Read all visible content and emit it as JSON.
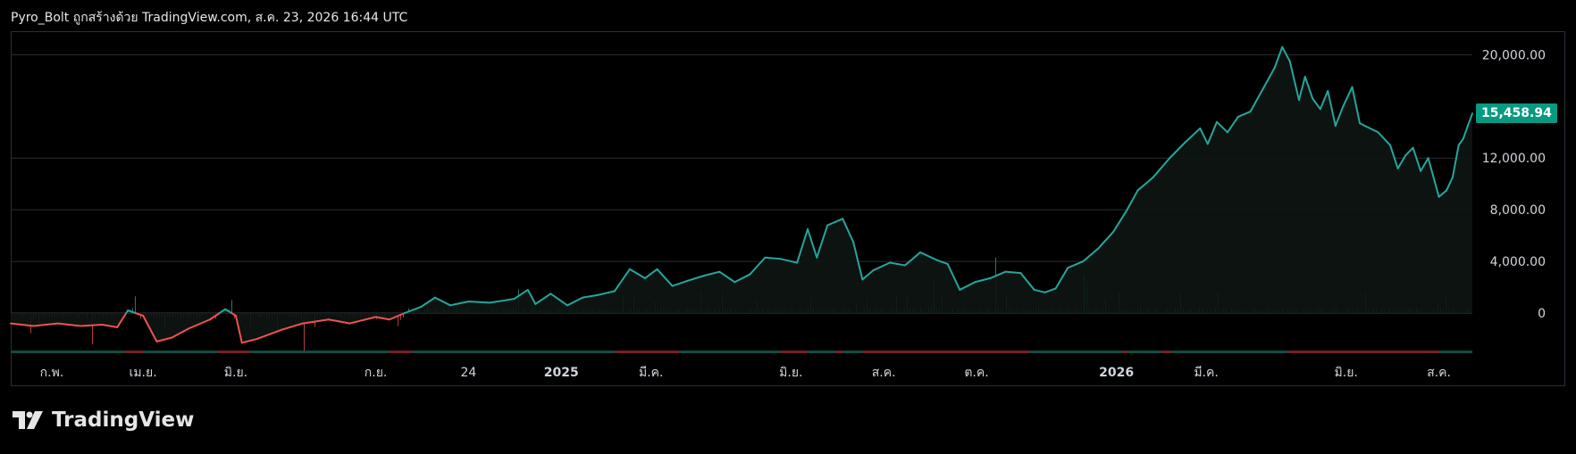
{
  "header": {
    "title": "Pyro_Bolt ถูกสร้างด้วย TradingView.com, ส.ค. 23, 2026 16:44 UTC"
  },
  "branding": {
    "logo_text": "TradingView",
    "logo_icon": "tradingview-logo-icon"
  },
  "colors": {
    "up": "#26a69a",
    "down": "#ef5350",
    "badge": "#089981",
    "grid": "#2a2e39",
    "band_up": "#0e4d44",
    "band_down": "#7a1c23"
  },
  "chart_data": {
    "type": "line",
    "title": "",
    "xlabel": "",
    "ylabel": "",
    "ylim": [
      -3000,
      21500
    ],
    "y_ticks": [
      0,
      4000,
      8000,
      12000,
      20000
    ],
    "y_tick_labels": [
      "0",
      "4,000.00",
      "8,000.00",
      "12,000.00",
      "20,000.00"
    ],
    "x_range": [
      "2024-01-05",
      "2026-08-23"
    ],
    "x_ticks": [
      {
        "date": "2024-02-01",
        "label": "ก.พ.",
        "bold": false
      },
      {
        "date": "2024-04-01",
        "label": "เม.ย.",
        "bold": false
      },
      {
        "date": "2024-06-01",
        "label": "มิ.ย.",
        "bold": false
      },
      {
        "date": "2024-09-01",
        "label": "ก.ย.",
        "bold": false
      },
      {
        "date": "2024-11-01",
        "label": "24",
        "bold": false
      },
      {
        "date": "2025-01-01",
        "label": "2025",
        "bold": true
      },
      {
        "date": "2025-03-01",
        "label": "มี.ค.",
        "bold": false
      },
      {
        "date": "2025-06-01",
        "label": "มิ.ย.",
        "bold": false
      },
      {
        "date": "2025-08-01",
        "label": "ส.ค.",
        "bold": false
      },
      {
        "date": "2025-10-01",
        "label": "ต.ค.",
        "bold": false
      },
      {
        "date": "2026-01-01",
        "label": "2026",
        "bold": true
      },
      {
        "date": "2026-03-01",
        "label": "มี.ค.",
        "bold": false
      },
      {
        "date": "2026-06-01",
        "label": "มิ.ย.",
        "bold": false
      },
      {
        "date": "2026-08-01",
        "label": "ส.ค.",
        "bold": false
      }
    ],
    "last_value": 15458.94,
    "last_value_label": "15,458.94",
    "series": [
      {
        "points": [
          [
            "2024-01-05",
            -800
          ],
          [
            "2024-01-20",
            -1000
          ],
          [
            "2024-02-05",
            -800
          ],
          [
            "2024-02-20",
            -1000
          ],
          [
            "2024-03-05",
            -900
          ],
          [
            "2024-03-15",
            -1100
          ],
          [
            "2024-03-22",
            200
          ],
          [
            "2024-04-01",
            -200
          ],
          [
            "2024-04-10",
            -2200
          ],
          [
            "2024-04-20",
            -1900
          ],
          [
            "2024-05-01",
            -1200
          ],
          [
            "2024-05-15",
            -500
          ],
          [
            "2024-05-25",
            300
          ],
          [
            "2024-06-01",
            -200
          ],
          [
            "2024-06-05",
            -2300
          ],
          [
            "2024-06-15",
            -2000
          ],
          [
            "2024-07-01",
            -1300
          ],
          [
            "2024-07-15",
            -800
          ],
          [
            "2024-08-01",
            -500
          ],
          [
            "2024-08-15",
            -800
          ],
          [
            "2024-09-01",
            -300
          ],
          [
            "2024-09-10",
            -500
          ],
          [
            "2024-09-20",
            0
          ],
          [
            "2024-10-01",
            500
          ],
          [
            "2024-10-10",
            1200
          ],
          [
            "2024-10-20",
            600
          ],
          [
            "2024-11-01",
            900
          ],
          [
            "2024-11-15",
            800
          ],
          [
            "2024-12-01",
            1100
          ],
          [
            "2024-12-10",
            1800
          ],
          [
            "2024-12-15",
            700
          ],
          [
            "2024-12-25",
            1500
          ],
          [
            "2025-01-05",
            600
          ],
          [
            "2025-01-15",
            1200
          ],
          [
            "2025-01-25",
            1400
          ],
          [
            "2025-02-05",
            1700
          ],
          [
            "2025-02-15",
            3400
          ],
          [
            "2025-02-25",
            2700
          ],
          [
            "2025-03-05",
            3400
          ],
          [
            "2025-03-15",
            2100
          ],
          [
            "2025-03-25",
            2500
          ],
          [
            "2025-04-05",
            2900
          ],
          [
            "2025-04-15",
            3200
          ],
          [
            "2025-04-25",
            2400
          ],
          [
            "2025-05-05",
            3000
          ],
          [
            "2025-05-15",
            4300
          ],
          [
            "2025-05-25",
            4200
          ],
          [
            "2025-06-05",
            3900
          ],
          [
            "2025-06-12",
            6500
          ],
          [
            "2025-06-18",
            4300
          ],
          [
            "2025-06-25",
            6800
          ],
          [
            "2025-07-05",
            7300
          ],
          [
            "2025-07-12",
            5500
          ],
          [
            "2025-07-18",
            2600
          ],
          [
            "2025-07-25",
            3300
          ],
          [
            "2025-08-05",
            3900
          ],
          [
            "2025-08-15",
            3700
          ],
          [
            "2025-08-25",
            4700
          ],
          [
            "2025-09-05",
            4100
          ],
          [
            "2025-09-12",
            3800
          ],
          [
            "2025-09-20",
            1800
          ],
          [
            "2025-09-30",
            2400
          ],
          [
            "2025-10-10",
            2700
          ],
          [
            "2025-10-20",
            3200
          ],
          [
            "2025-10-30",
            3100
          ],
          [
            "2025-11-08",
            1800
          ],
          [
            "2025-11-15",
            1600
          ],
          [
            "2025-11-22",
            1900
          ],
          [
            "2025-11-30",
            3500
          ],
          [
            "2025-12-10",
            4000
          ],
          [
            "2025-12-20",
            5000
          ],
          [
            "2025-12-30",
            6300
          ],
          [
            "2026-01-08",
            8000
          ],
          [
            "2026-01-15",
            9500
          ],
          [
            "2026-01-25",
            10500
          ],
          [
            "2026-02-05",
            12000
          ],
          [
            "2026-02-15",
            13200
          ],
          [
            "2026-02-25",
            14300
          ],
          [
            "2026-03-02",
            13100
          ],
          [
            "2026-03-08",
            14800
          ],
          [
            "2026-03-15",
            14000
          ],
          [
            "2026-03-22",
            15200
          ],
          [
            "2026-03-30",
            15600
          ],
          [
            "2026-04-08",
            17500
          ],
          [
            "2026-04-15",
            19000
          ],
          [
            "2026-04-20",
            20600
          ],
          [
            "2026-04-25",
            19500
          ],
          [
            "2026-05-01",
            16500
          ],
          [
            "2026-05-05",
            18300
          ],
          [
            "2026-05-10",
            16600
          ],
          [
            "2026-05-15",
            15800
          ],
          [
            "2026-05-20",
            17200
          ],
          [
            "2026-05-25",
            14500
          ],
          [
            "2026-05-30",
            16000
          ],
          [
            "2026-06-05",
            17500
          ],
          [
            "2026-06-10",
            14700
          ],
          [
            "2026-06-15",
            14400
          ],
          [
            "2026-06-22",
            14000
          ],
          [
            "2026-06-30",
            13000
          ],
          [
            "2026-07-05",
            11200
          ],
          [
            "2026-07-10",
            12200
          ],
          [
            "2026-07-15",
            12800
          ],
          [
            "2026-07-20",
            11000
          ],
          [
            "2026-07-25",
            12000
          ],
          [
            "2026-08-01",
            9000
          ],
          [
            "2026-08-06",
            9500
          ],
          [
            "2026-08-10",
            10500
          ],
          [
            "2026-08-14",
            13000
          ],
          [
            "2026-08-17",
            13500
          ],
          [
            "2026-08-20",
            14500
          ],
          [
            "2026-08-23",
            15458.94
          ]
        ]
      }
    ]
  }
}
